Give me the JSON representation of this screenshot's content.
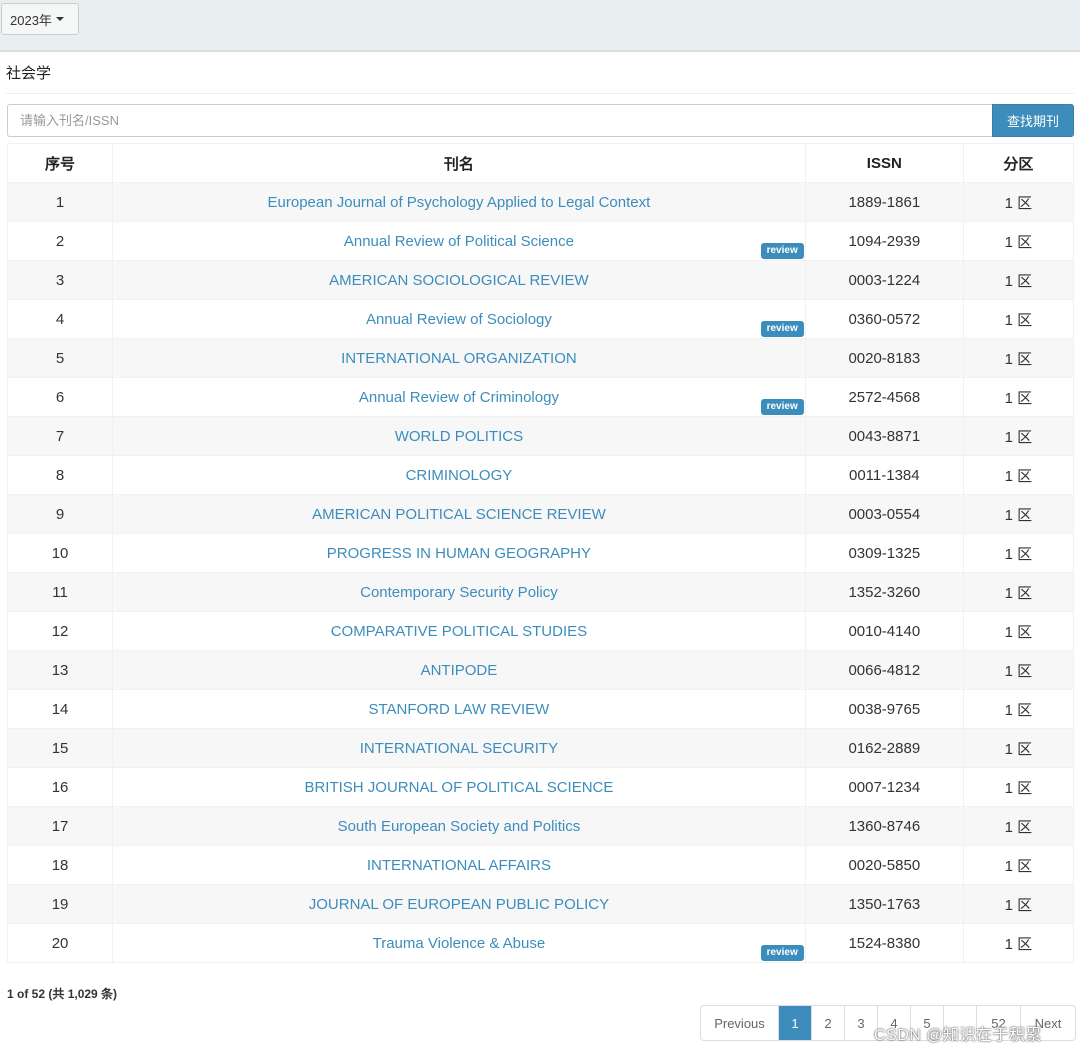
{
  "year_selector": {
    "label": "2023年"
  },
  "subject": "社会学",
  "search": {
    "placeholder": "请输入刊名/ISSN",
    "value": "",
    "button_label": "查找期刊"
  },
  "table": {
    "headers": {
      "no": "序号",
      "name": "刊名",
      "issn": "ISSN",
      "zone": "分区"
    },
    "rows": [
      {
        "no": "1",
        "name": "European Journal of Psychology Applied to Legal Context",
        "issn": "1889-1861",
        "zone": "1 区",
        "badge": ""
      },
      {
        "no": "2",
        "name": "Annual Review of Political Science",
        "issn": "1094-2939",
        "zone": "1 区",
        "badge": "review"
      },
      {
        "no": "3",
        "name": "AMERICAN SOCIOLOGICAL REVIEW",
        "issn": "0003-1224",
        "zone": "1 区",
        "badge": ""
      },
      {
        "no": "4",
        "name": "Annual Review of Sociology",
        "issn": "0360-0572",
        "zone": "1 区",
        "badge": "review"
      },
      {
        "no": "5",
        "name": "INTERNATIONAL ORGANIZATION",
        "issn": "0020-8183",
        "zone": "1 区",
        "badge": ""
      },
      {
        "no": "6",
        "name": "Annual Review of Criminology",
        "issn": "2572-4568",
        "zone": "1 区",
        "badge": "review"
      },
      {
        "no": "7",
        "name": "WORLD POLITICS",
        "issn": "0043-8871",
        "zone": "1 区",
        "badge": ""
      },
      {
        "no": "8",
        "name": "CRIMINOLOGY",
        "issn": "0011-1384",
        "zone": "1 区",
        "badge": ""
      },
      {
        "no": "9",
        "name": "AMERICAN POLITICAL SCIENCE REVIEW",
        "issn": "0003-0554",
        "zone": "1 区",
        "badge": ""
      },
      {
        "no": "10",
        "name": "PROGRESS IN HUMAN GEOGRAPHY",
        "issn": "0309-1325",
        "zone": "1 区",
        "badge": ""
      },
      {
        "no": "11",
        "name": "Contemporary Security Policy",
        "issn": "1352-3260",
        "zone": "1 区",
        "badge": ""
      },
      {
        "no": "12",
        "name": "COMPARATIVE POLITICAL STUDIES",
        "issn": "0010-4140",
        "zone": "1 区",
        "badge": ""
      },
      {
        "no": "13",
        "name": "ANTIPODE",
        "issn": "0066-4812",
        "zone": "1 区",
        "badge": ""
      },
      {
        "no": "14",
        "name": "STANFORD LAW REVIEW",
        "issn": "0038-9765",
        "zone": "1 区",
        "badge": ""
      },
      {
        "no": "15",
        "name": "INTERNATIONAL SECURITY",
        "issn": "0162-2889",
        "zone": "1 区",
        "badge": ""
      },
      {
        "no": "16",
        "name": "BRITISH JOURNAL OF POLITICAL SCIENCE",
        "issn": "0007-1234",
        "zone": "1 区",
        "badge": ""
      },
      {
        "no": "17",
        "name": "South European Society and Politics",
        "issn": "1360-8746",
        "zone": "1 区",
        "badge": ""
      },
      {
        "no": "18",
        "name": "INTERNATIONAL AFFAIRS",
        "issn": "0020-5850",
        "zone": "1 区",
        "badge": ""
      },
      {
        "no": "19",
        "name": "JOURNAL OF EUROPEAN PUBLIC POLICY",
        "issn": "1350-1763",
        "zone": "1 区",
        "badge": ""
      },
      {
        "no": "20",
        "name": "Trauma Violence & Abuse",
        "issn": "1524-8380",
        "zone": "1 区",
        "badge": "review"
      }
    ]
  },
  "info": {
    "page_text": "1 of 52",
    "total_text": "(共 1,029 条)"
  },
  "pagination": {
    "previous": "Previous",
    "pages": [
      "1",
      "2",
      "3",
      "4",
      "5",
      "",
      "52"
    ],
    "active_page": "1",
    "next": "Next"
  },
  "watermark": "CSDN @知识在于积累",
  "colors": {
    "accent": "#3c8dbc",
    "topbar": "#e9eef0"
  }
}
